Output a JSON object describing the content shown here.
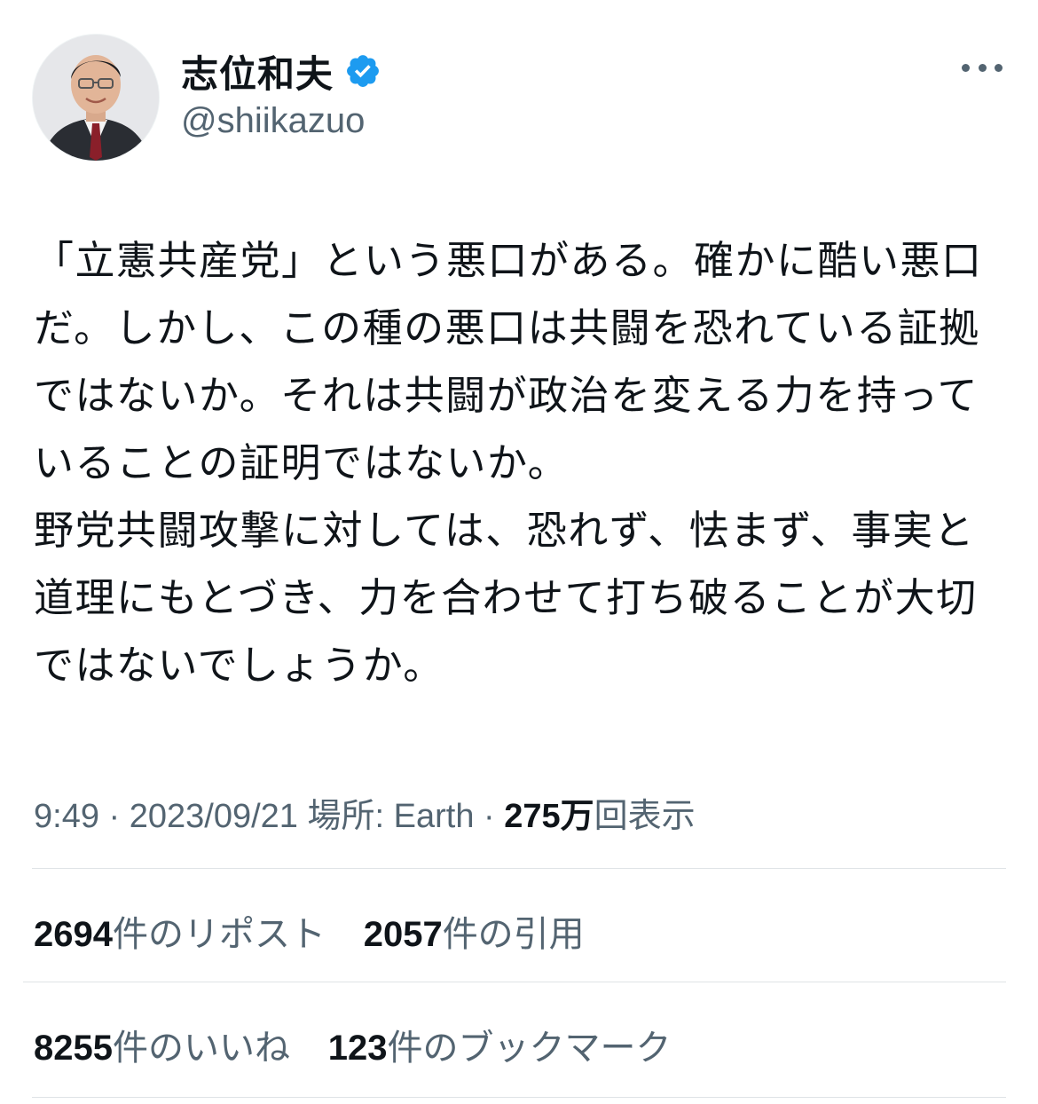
{
  "author": {
    "display_name": "志位和夫",
    "handle": "@shiikazuo",
    "verified_icon": "verified-badge-icon",
    "avatar_icon": "avatar-photo"
  },
  "menu": {
    "more_icon": "more-options-icon"
  },
  "tweet": {
    "text": "「立憲共産党」という悪口がある。確かに酷い悪口だ。しかし、この種の悪口は共闘を恐れている証拠ではないか。それは共闘が政治を変える力を持っていることの証明ではないか。\n野党共闘攻撃に対しては、恐れず、怯まず、事実と道理にもとづき、力を合わせて打ち破ることが大切ではないでしょうか。"
  },
  "meta": {
    "time": "9:49",
    "separator": " · ",
    "date": "2023/09/21",
    "location_label": "場所: ",
    "location": "Earth",
    "views_count": "275万",
    "views_label": "回表示"
  },
  "stats": {
    "reposts_count": "2694",
    "reposts_label": "件のリポスト",
    "quotes_count": "2057",
    "quotes_label": "件の引用",
    "likes_count": "8255",
    "likes_label": "件のいいね",
    "bookmarks_count": "123",
    "bookmarks_label": "件のブックマーク"
  },
  "colors": {
    "text_primary": "#0f1419",
    "text_secondary": "#536471",
    "verified_blue": "#1d9bf0",
    "divider": "#dfe3e6"
  }
}
